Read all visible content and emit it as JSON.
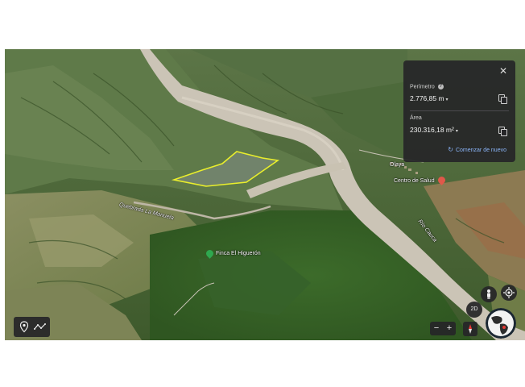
{
  "labels": {
    "olaya": "Olaya",
    "centro_salud": "Centro de Salud",
    "quebrada": "Quebrada La Manuela",
    "finca": "Finca El Higuerón",
    "river": "Río Cauca"
  },
  "measure_panel": {
    "close_label": "✕",
    "perimeter_label": "Perímetro",
    "help_label": "?",
    "perimeter_value": "2.776,85 m",
    "area_label": "Área",
    "area_value": "230.316,18 m²",
    "caret": "▾",
    "restart_label": "Comenzar de nuevo",
    "restart_icon": "restart-icon"
  },
  "controls": {
    "view_mode": "2D",
    "zoom_out": "−",
    "zoom_in": "+",
    "icons": [
      "location-pin-icon",
      "path-icon",
      "pegman-icon",
      "my-location-icon",
      "compass-icon",
      "globe-icon"
    ]
  },
  "colors": {
    "polygon_outline": "#e9ee2c",
    "panel_bg": "#262628",
    "link_blue": "#8ab4f8",
    "compass_red": "#e53935"
  }
}
